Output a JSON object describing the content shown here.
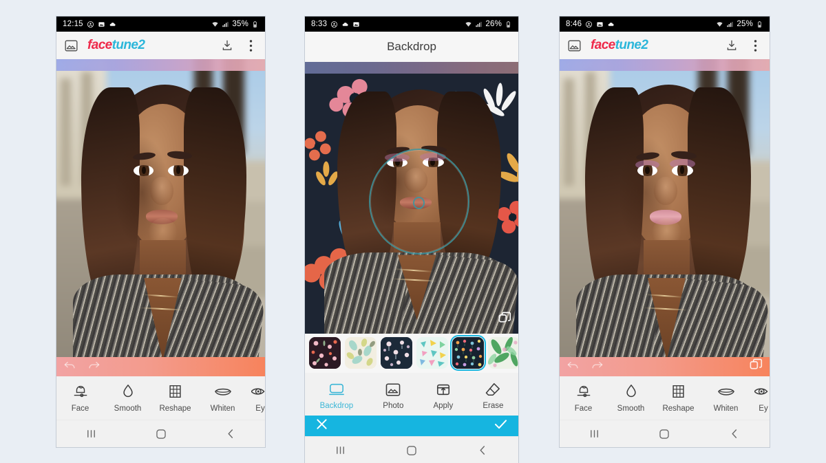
{
  "page": {
    "background_color": "#e9eef4"
  },
  "palette": {
    "accent_cyan": "#16b5e0",
    "logo_red": "#ee2a4a",
    "logo_cyan": "#2bb6da",
    "brush_teal": "#3c96a0",
    "selected_thumb_border": "#17b6e0"
  },
  "phones": [
    {
      "id": "phone-1",
      "status": {
        "time": "12:15",
        "battery": "35%",
        "icons": [
          "account-icon",
          "image-icon",
          "cloud-icon",
          "wifi-icon",
          "signal-icon",
          "battery-icon"
        ]
      },
      "appbar": {
        "type": "logo",
        "logo_part1": "face",
        "logo_part2": "tune2",
        "left_icon": "gallery-icon",
        "right_icons": [
          "download-icon",
          "overflow-menu-icon"
        ]
      },
      "canvas": {
        "overlay_icons": [
          "undo-icon",
          "redo-icon"
        ]
      },
      "tools": [
        {
          "label": "Face",
          "icon": "face-icon",
          "active": false
        },
        {
          "label": "Smooth",
          "icon": "droplet-icon",
          "active": false
        },
        {
          "label": "Reshape",
          "icon": "grid-icon",
          "active": false
        },
        {
          "label": "Whiten",
          "icon": "teeth-icon",
          "active": false
        },
        {
          "label": "Ey",
          "icon": "eye-icon",
          "active": false
        }
      ],
      "navbar": [
        "recents-icon",
        "home-icon",
        "back-icon"
      ]
    },
    {
      "id": "phone-2",
      "status": {
        "time": "8:33",
        "battery": "26%",
        "icons": [
          "account-icon",
          "cloud-icon",
          "image-icon",
          "wifi-icon",
          "signal-icon",
          "battery-icon"
        ]
      },
      "appbar": {
        "type": "title",
        "title": "Backdrop"
      },
      "canvas": {
        "overlay_icons": [
          "layers-icon"
        ],
        "brush_cursor": true
      },
      "thumbnails": [
        {
          "name": "backdrop-dark-floral",
          "selected": false
        },
        {
          "name": "backdrop-pastel-leaves",
          "selected": false
        },
        {
          "name": "backdrop-navy-blossom",
          "selected": false
        },
        {
          "name": "backdrop-confetti-shapes",
          "selected": false
        },
        {
          "name": "backdrop-navy-mini-flowers",
          "selected": true
        },
        {
          "name": "backdrop-green-tropical",
          "selected": false
        },
        {
          "name": "backdrop-jungle-green",
          "selected": false
        }
      ],
      "tools": [
        {
          "label": "Backdrop",
          "icon": "backdrop-icon",
          "active": true
        },
        {
          "label": "Photo",
          "icon": "photo-icon",
          "active": false
        },
        {
          "label": "Apply",
          "icon": "apply-icon",
          "active": false
        },
        {
          "label": "Erase",
          "icon": "eraser-icon",
          "active": false
        }
      ],
      "confirm": {
        "cancel_icon": "close-icon",
        "accept_icon": "check-icon"
      },
      "navbar": [
        "recents-icon",
        "home-icon",
        "back-icon"
      ]
    },
    {
      "id": "phone-3",
      "status": {
        "time": "8:46",
        "battery": "25%",
        "icons": [
          "account-icon",
          "image-icon",
          "cloud-icon",
          "wifi-icon",
          "signal-icon",
          "battery-icon"
        ]
      },
      "appbar": {
        "type": "logo",
        "logo_part1": "face",
        "logo_part2": "tune2",
        "left_icon": "gallery-icon",
        "right_icons": [
          "download-icon",
          "overflow-menu-icon"
        ]
      },
      "canvas": {
        "overlay_icons": [
          "undo-icon",
          "redo-icon",
          "layers-icon"
        ]
      },
      "tools": [
        {
          "label": "Face",
          "icon": "face-icon",
          "active": false
        },
        {
          "label": "Smooth",
          "icon": "droplet-icon",
          "active": false
        },
        {
          "label": "Reshape",
          "icon": "grid-icon",
          "active": false
        },
        {
          "label": "Whiten",
          "icon": "teeth-icon",
          "active": false
        },
        {
          "label": "Ey",
          "icon": "eye-icon",
          "active": false
        }
      ],
      "navbar": [
        "recents-icon",
        "home-icon",
        "back-icon"
      ]
    }
  ]
}
